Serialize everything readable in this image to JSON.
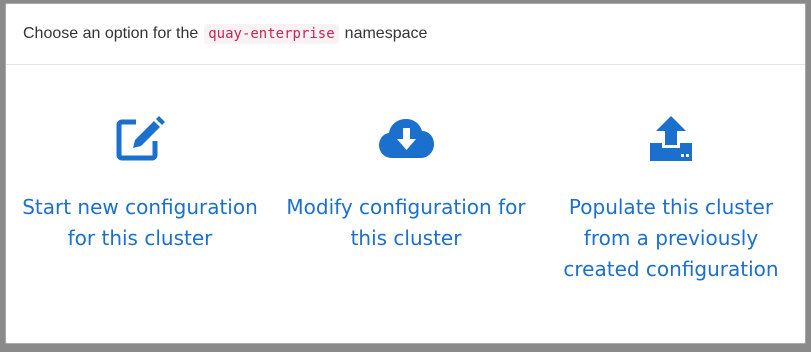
{
  "dialog": {
    "header_prefix": "Choose an option for the",
    "namespace": "quay-enterprise",
    "header_suffix": "namespace"
  },
  "options": [
    {
      "label": "Start new configuration for this cluster",
      "icon": "edit-icon"
    },
    {
      "label": "Modify configuration for this cluster",
      "icon": "cloud-download-icon"
    },
    {
      "label": "Populate this cluster from a previously created configuration",
      "icon": "upload-icon"
    }
  ],
  "colors": {
    "accent": "#1b6fcd",
    "namespace_text": "#c7254e",
    "namespace_bg": "#f9f2f4",
    "backdrop": "#8a8a8a"
  }
}
